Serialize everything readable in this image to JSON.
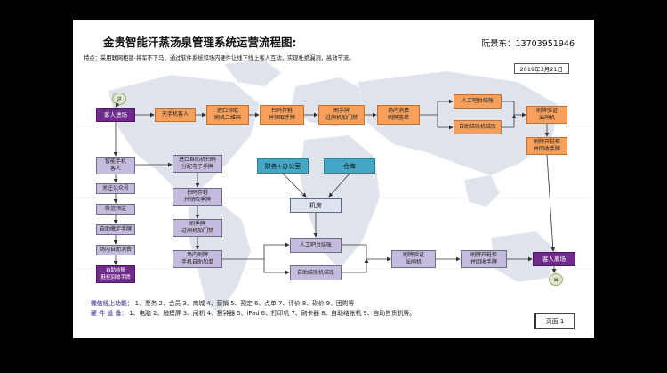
{
  "title": "金贵智能汗蒸汤泉管理系统运营流程图:",
  "contact": "阮景东：13703951946",
  "feature": "特点：采用联网柜锁-将军不下马，通过软件系统和场内硬件让线下线上客人互动，实现杜绝漏洞，高效节流。",
  "date": "2019年3月21日",
  "bubbles": {
    "entry": "进",
    "exit": "出"
  },
  "boxes": {
    "guest_arrive": "客人进场",
    "no_phone": "无手机客人",
    "front_desk": "进口领取\n刷机二维码",
    "scan_store": "扫码存鞋\n并领取手牌",
    "swipe_gate": "刷手牌\n过闸机加门禁",
    "consume": "场内消费\n刷牌签单",
    "manual_checkout_top": "人工吧台结账",
    "self_checkout_top": "自助结账机结账",
    "swipe_exit_top": "刷牌验证\n出闸机",
    "swipe_shoe_top": "刷牌开鞋柜\n并回收手牌",
    "smart_phone": "智能手机\n客人",
    "follow_public": "关注公众号",
    "wechat_book": "微信预定",
    "self_claim": "自助缴定手牌",
    "self_consume": "场内自助消费",
    "self_checkout_left": "自助结账\n鞋柜回收手牌",
    "kiosk_scan": "进口自助机扫码\n分配电子手牌",
    "scan_store2": "扫码存鞋\n并领取手牌",
    "swipe_gate2": "刷手牌\n过闸机加门禁",
    "swipe_open": "场内刷牌\n手机自助加单",
    "finance": "财务+办公室",
    "warehouse": "仓库",
    "machine_room": "机房",
    "manual_checkout_bottom": "人工吧台结账",
    "self_checkout_bottom": "自助结账机结账",
    "swipe_exit_bottom": "刷牌验证\n出闸机",
    "swipe_shoe_bottom": "刷牌开鞋柜\n并回收手牌",
    "guest_leave": "客人离场"
  },
  "footer": {
    "wechat_label": "微信线上功能：",
    "wechat_items": "1、票务  2、会员  3、商城  4、营销  5、预定 6、点单  7、评价  8、砍价  9、团购等",
    "hardware_label": "硬 件 设 备：",
    "hardware_items": "1、电脑 2、触摸屏 3、闸机 4、报钟器 5、iPad 6、打印机 7、刷卡器 8、自助结账机 9、自助售货机等。"
  },
  "page_label": "页面 1",
  "colors": {
    "purple": "#6f2a8c",
    "lavender": "#c5bbdd",
    "orange": "#f6a05c",
    "teal": "#44a8c4",
    "map": "#dde2ea"
  }
}
